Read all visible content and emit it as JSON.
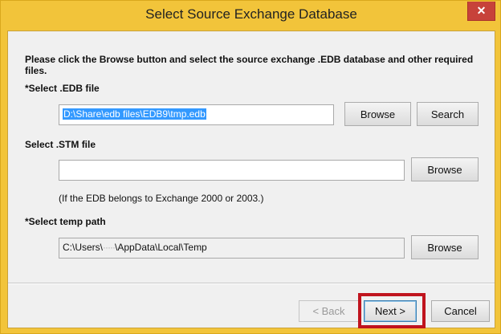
{
  "window": {
    "title": "Select Source Exchange Database",
    "close_glyph": "✕"
  },
  "instructions": "Please click the Browse button and select the source exchange .EDB database and other required files.",
  "edb": {
    "label": "*Select .EDB file",
    "value": "D:\\Share\\edb files\\EDB9\\tmp.edb",
    "browse_label": "Browse",
    "search_label": "Search"
  },
  "stm": {
    "label": "Select .STM file",
    "value": "",
    "browse_label": "Browse",
    "note": "(If the EDB belongs to Exchange 2000 or 2003.)"
  },
  "temp": {
    "label": "*Select temp path",
    "value_prefix": "C:\\Users\\",
    "value_redacted": "·····",
    "value_suffix": "\\AppData\\Local\\Temp",
    "browse_label": "Browse"
  },
  "footer": {
    "back_label": "< Back",
    "next_label": "Next >",
    "cancel_label": "Cancel"
  },
  "colors": {
    "frame": "#f2c43a",
    "highlight": "#c0141e",
    "selection": "#3399ff"
  },
  "icons": {
    "close": "close-icon"
  }
}
